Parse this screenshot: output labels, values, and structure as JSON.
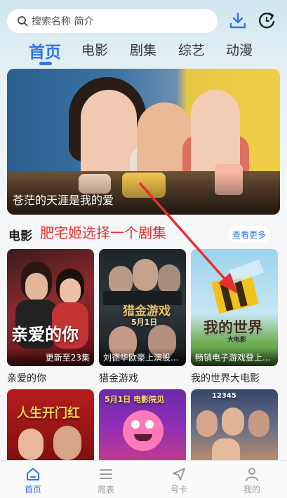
{
  "search": {
    "placeholder": "搜索名称 简介"
  },
  "tabs": [
    {
      "label": "首页",
      "active": true
    },
    {
      "label": "电影"
    },
    {
      "label": "剧集"
    },
    {
      "label": "综艺"
    },
    {
      "label": "动漫"
    }
  ],
  "banner": {
    "title": "苍茫的天涯是我的爱"
  },
  "section": {
    "title": "电影",
    "more_label": "查看更多"
  },
  "annotation": "肥宅姬选择一个剧集",
  "cards": [
    {
      "name": "亲爱的你",
      "caption": "更新至23集",
      "poster_title": "亲爱的你"
    },
    {
      "name": "猎金游戏",
      "caption": "刘德华欧豪上演股...",
      "poster_title": "猎金游戏",
      "poster_date": "5月1日"
    },
    {
      "name": "我的世界大电影",
      "caption": "畅销电子游戏登上...",
      "poster_title": "我的世界",
      "poster_sub": "大电影"
    },
    {
      "poster_title": "人生开门红"
    },
    {
      "poster_title": "5月1日 电影院见"
    },
    {
      "poster_title": "12345"
    }
  ],
  "nav": [
    {
      "label": "首页",
      "active": true
    },
    {
      "label": "周表"
    },
    {
      "label": "号卡"
    },
    {
      "label": "我的"
    }
  ],
  "colors": {
    "accent": "#2f74e8",
    "annotation": "#e53030"
  }
}
